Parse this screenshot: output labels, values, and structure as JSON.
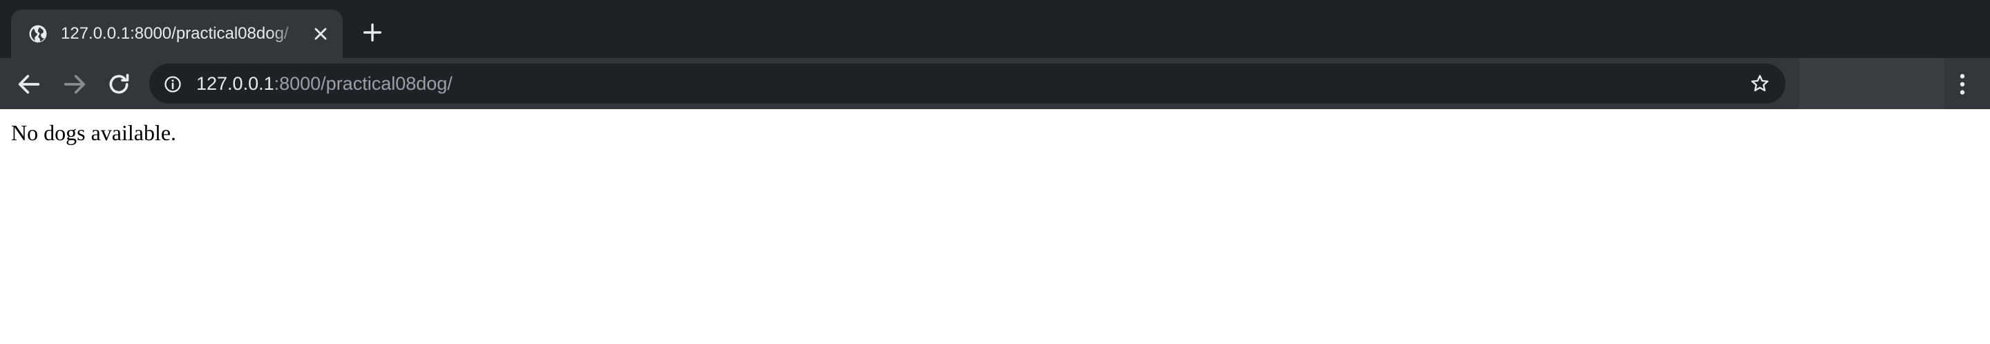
{
  "browser": {
    "tab": {
      "favicon": "globe-icon",
      "title": "127.0.0.1:8000/practical08dog/",
      "close_icon": "close-icon"
    },
    "new_tab_icon": "plus-icon",
    "toolbar": {
      "back_icon": "arrow-left-icon",
      "forward_icon": "arrow-right-icon",
      "reload_icon": "reload-icon",
      "site_info_icon": "info-icon",
      "url_host": "127.0.0.1",
      "url_rest": ":8000/practical08dog/",
      "bookmark_icon": "star-icon",
      "menu_icon": "kebab-menu-icon"
    },
    "colors": {
      "tabstrip_bg": "#202124",
      "toolbar_bg": "#35363a",
      "omnibox_bg": "#202124",
      "text_primary": "#e8eaed",
      "text_secondary": "#9aa0a6"
    }
  },
  "page": {
    "message": "No dogs available."
  }
}
